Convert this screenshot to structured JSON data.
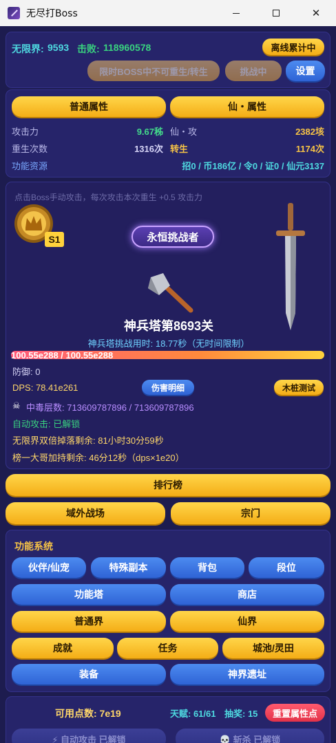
{
  "window": {
    "title": "无尽打Boss",
    "minimize_glyph": "",
    "maximize_glyph": "",
    "close_glyph": "✕"
  },
  "header": {
    "realm_label": "无限界:",
    "realm_value": "9593",
    "kills_label": "击败:",
    "kills_value": "118960578",
    "offline_button": "离线累计中",
    "rebirth_disabled": "限时BOSS中不可重生/转生",
    "challenging_button": "挑战中",
    "settings_button": "设置"
  },
  "attributes": {
    "tab_normal": "普通属性",
    "tab_immortal": "仙・属性",
    "rows": [
      {
        "label": "攻击力",
        "value": "9.67秭",
        "label2": "仙・攻",
        "value2": "2382垓"
      },
      {
        "label": "重生次数",
        "value": "1316次",
        "label2": "转生",
        "value2": "1174次"
      }
    ],
    "resource_label": "功能资源",
    "resource_value": "招0 / 币186亿 / 令0 / 证0 / 仙元3137"
  },
  "boss": {
    "hint": "点击Boss手动攻击，每次攻击本次重生 +0.5 攻击力",
    "stage_badge": "S1",
    "title_badge": "永恒挑战者",
    "weapon_icon": "axe-icon",
    "name": "神兵塔第8693关",
    "timer": "神兵塔挑战用时: 18.77秒（无时间限制）",
    "hp_text": "100.55e288 / 100.55e288",
    "hp_fraction": 1.0,
    "defense": "防御: 0",
    "dps": "DPS: 78.41e261",
    "damage_detail_button": "伤害明细",
    "dummy_test_button": "木桩测试",
    "poison": "中毒层数: 713609787896 / 713609787896",
    "auto_attack": "自动攻击: 已解锁",
    "double_drop": "无限界双倍掉落剩余:  81小时30分59秒",
    "rank_buff": "榜一大哥加持剩余:  46分12秒（dps×1e20）"
  },
  "nav": {
    "leaderboard": "排行榜",
    "outer_battlefield": "域外战场",
    "sect": "宗门"
  },
  "functions": {
    "title": "功能系统",
    "row1": [
      "伙伴/仙宠",
      "特殊副本",
      "背包",
      "段位"
    ],
    "row2": [
      "功能塔",
      "商店"
    ],
    "row3": [
      "普通界",
      "仙界"
    ],
    "row4": [
      "成就",
      "任务",
      "城池/灵田"
    ],
    "row5": [
      "装备",
      "神界遗址"
    ]
  },
  "footer": {
    "points": "可用点数: 7e19",
    "talent": "天赋: 61/61",
    "lottery": "抽奖: 15",
    "reset_button": "重置属性点",
    "auto_attack_unlocked": "⚡ 自动攻击 已解锁",
    "kill_unlocked": "💀 斩杀 已解锁"
  },
  "colors": {
    "background": "#1d1c4f",
    "panel": "#26246a",
    "gold": "#f6c346",
    "green": "#43d88a",
    "cyan": "#4ed9e0",
    "blue_button": "#3b72e0"
  }
}
